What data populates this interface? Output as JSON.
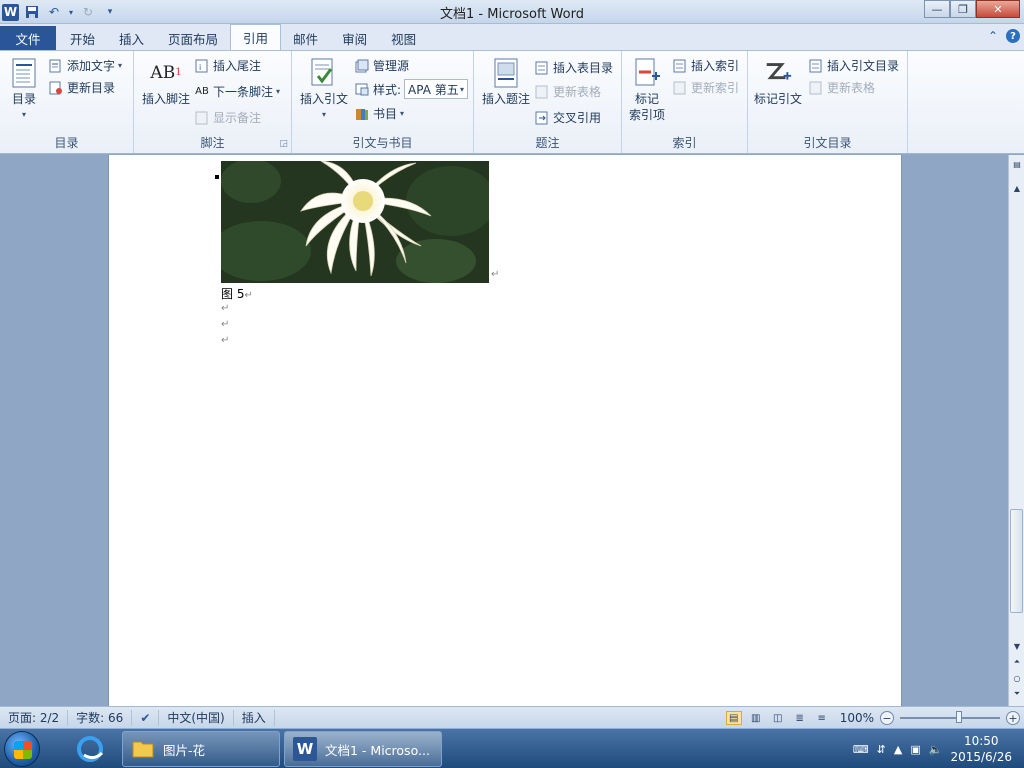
{
  "window": {
    "title": "文档1 - Microsoft Word"
  },
  "tabs": [
    {
      "label": "文件"
    },
    {
      "label": "开始"
    },
    {
      "label": "插入"
    },
    {
      "label": "页面布局"
    },
    {
      "label": "引用"
    },
    {
      "label": "邮件"
    },
    {
      "label": "审阅"
    },
    {
      "label": "视图"
    }
  ],
  "ribbon": {
    "toc": {
      "big": "目录",
      "add_text": "添加文字",
      "update": "更新目录",
      "label": "目录"
    },
    "footnote": {
      "insert_footnote": "插入脚注",
      "insert_endnote": "插入尾注",
      "next_footnote": "下一条脚注",
      "show_notes": "显示备注",
      "label": "脚注"
    },
    "citation": {
      "insert_citation": "插入引文",
      "manage_sources": "管理源",
      "style_label": "样式:",
      "style_value": "APA 第五",
      "bibliography": "书目",
      "label": "引文与书目"
    },
    "caption": {
      "insert_caption": "插入题注",
      "insert_table_of_figures": "插入表目录",
      "update_table": "更新表格",
      "cross_reference": "交叉引用",
      "label": "题注"
    },
    "index": {
      "mark_entry_line1": "标记",
      "mark_entry_line2": "索引项",
      "insert_index": "插入索引",
      "update_index": "更新索引",
      "label": "索引"
    },
    "toa": {
      "mark_citation": "标记引文",
      "insert_toa": "插入引文目录",
      "update_table": "更新表格",
      "label": "引文目录"
    }
  },
  "document": {
    "caption": "图  5"
  },
  "status": {
    "page": "页面: 2/2",
    "words": "字数: 66",
    "language": "中文(中国)",
    "mode": "插入",
    "zoom": "100%"
  },
  "taskbar": {
    "folder_task": "图片-花",
    "word_task": "文档1 - Microso...",
    "time": "10:50",
    "date": "2015/6/26"
  }
}
